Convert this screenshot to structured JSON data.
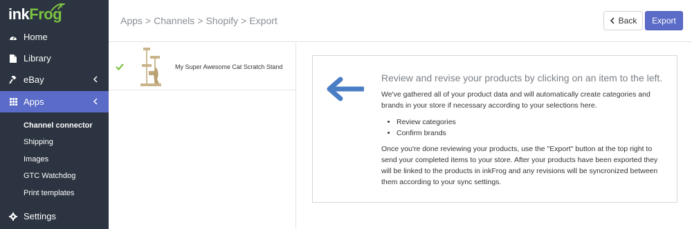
{
  "brand": {
    "name_part1": "ink",
    "name_part2": "Frog"
  },
  "sidebar": {
    "items": [
      {
        "label": "Home",
        "icon": "dashboard-icon"
      },
      {
        "label": "Library",
        "icon": "file-icon"
      },
      {
        "label": "eBay",
        "icon": "gavel-icon"
      },
      {
        "label": "Apps",
        "icon": "grid-icon"
      },
      {
        "label": "Settings",
        "icon": "gear-icon"
      }
    ],
    "subitems": [
      {
        "label": "Channel connector"
      },
      {
        "label": "Shipping"
      },
      {
        "label": "Images"
      },
      {
        "label": "GTC Watchdog"
      },
      {
        "label": "Print templates"
      }
    ]
  },
  "header": {
    "breadcrumb": [
      "Apps",
      "Channels",
      "Shopify",
      "Export"
    ],
    "separator": ">",
    "back_label": "Back",
    "export_label": "Export"
  },
  "products": [
    {
      "name": "My Super Awesome Cat Scratch Stand",
      "status": "ready"
    }
  ],
  "panel": {
    "title": "Review and revise your products by clicking on an item to the left.",
    "intro": "We've gathered all of your product data and will automatically create categories and brands in your store if necessary according to your selections here.",
    "bullets": [
      "Review categories",
      "Confirm brands"
    ],
    "outro": "Once you're done reviewing your products, use the \"Export\" button at the top right to send your completed items to your store. After your products have been exported they will be linked to the products in inkFrog and any revisions will be syncronized between them according to your sync settings."
  },
  "colors": {
    "sidebar_bg": "#2b3440",
    "accent": "#5b6cc8",
    "check": "#7cc242",
    "arrow": "#4a7ec4"
  }
}
